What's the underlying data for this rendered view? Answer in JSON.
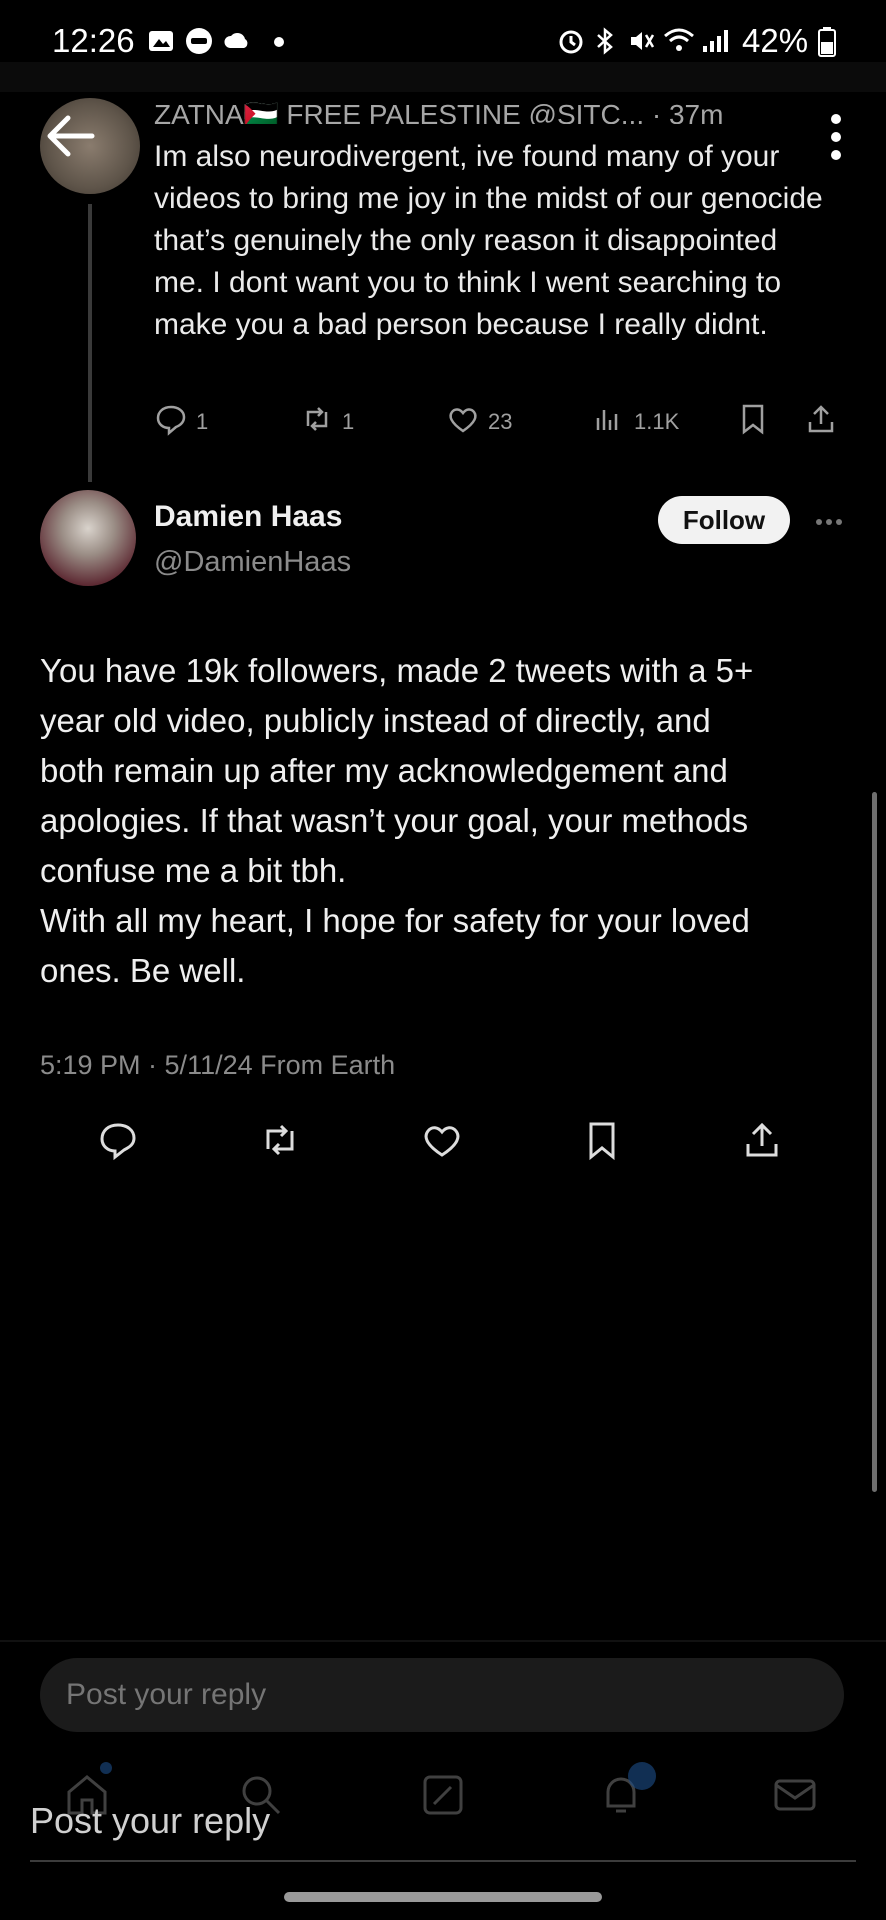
{
  "status_bar": {
    "time": "12:26",
    "battery": "42%",
    "left_icons": [
      "gallery-icon",
      "wear-icon",
      "cloud-icon",
      "dot-icon"
    ],
    "right_icons": [
      "alarm-icon",
      "bluetooth-icon",
      "mute-icon",
      "wifi-icon",
      "signal-icon",
      "battery-icon"
    ]
  },
  "parent_tweet": {
    "author_line": "ZATNA🇵🇸 FREE PALESTINE @SITC... · 37m",
    "text": "Im also neurodivergent, ive found many of your videos to bring me joy in the midst of our genocide that’s genuinely the only reason it disappointed me. I dont want you to think I went searching to make you a bad person because I really didnt.",
    "replies": "1",
    "reposts": "1",
    "likes": "23",
    "views": "1.1K"
  },
  "main_tweet": {
    "author_name": "Damien Haas",
    "author_handle": "@DamienHaas",
    "follow_label": "Follow",
    "body_lines": [
      "You have 19k followers, made 2 tweets with a 5+",
      "year old video, publicly instead of directly, and",
      "both remain up after my acknowledgement and",
      "apologies. If that wasn’t your goal, your methods",
      "confuse me a bit tbh.",
      "With all my heart, I hope for safety for your loved",
      "ones. Be well."
    ],
    "meta": "5:19 PM · 5/11/24 From Earth"
  },
  "reply_box": {
    "placeholder": "Post your reply"
  },
  "overlay": {
    "reply_label": "Post your reply"
  },
  "colors": {
    "background": "#000000",
    "text": "#e7e9ea",
    "muted": "#8b8b8b",
    "follow_button": "#f2f2f2"
  }
}
